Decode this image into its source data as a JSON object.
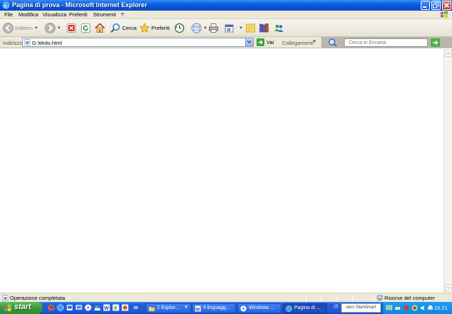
{
  "window": {
    "title": "Pagina di prova - Microsoft Internet Explorer"
  },
  "menu": {
    "items": [
      "File",
      "Modifica",
      "Visualizza",
      "Preferiti",
      "Strumenti",
      "?"
    ]
  },
  "toolbar": {
    "back_label": "Indietro",
    "search_label": "Cerca",
    "favorites_label": "Preferiti"
  },
  "address": {
    "label": "Indirizzo",
    "value": "G:\\titolo.html",
    "go_label": "Vai",
    "links_label": "Collegamenti",
    "links_more": "»"
  },
  "encarta": {
    "placeholder": "Cerca in Encarta"
  },
  "status": {
    "text": "Operazione completata",
    "zone": "Risorse del computer"
  },
  "taskbar": {
    "start_label": "start",
    "tasks": [
      {
        "label": "2 Esplor...",
        "active": false
      },
      {
        "label": "Il linguagg...",
        "active": false
      },
      {
        "label": "Windows ...",
        "active": false
      },
      {
        "label": "Pagina di ...",
        "active": true
      }
    ],
    "language": "IT",
    "nero_label": "nero StartSmart",
    "clock": "15.21"
  },
  "colors": {
    "titlebar": "#0a5fe0",
    "taskbar": "#245edb",
    "start": "#3a9a3a",
    "chrome": "#ece9d8"
  }
}
